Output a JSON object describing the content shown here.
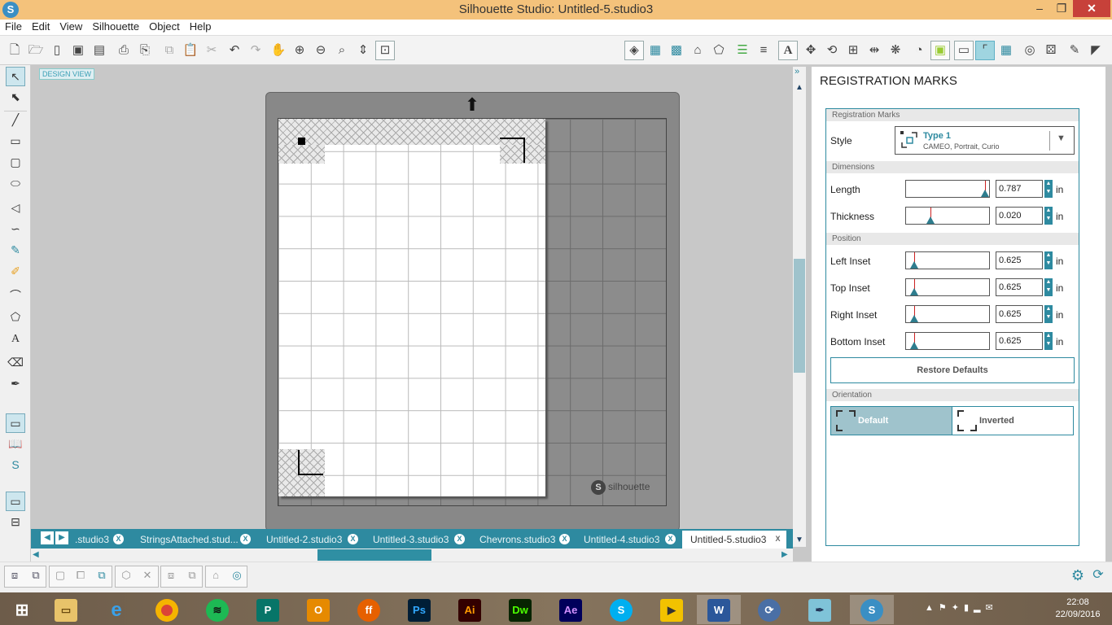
{
  "window": {
    "title": "Silhouette Studio: Untitled-5.studio3",
    "minimize": "‒",
    "restore": "❐",
    "close": "✕"
  },
  "menu": [
    "File",
    "Edit",
    "View",
    "Silhouette",
    "Object",
    "Help"
  ],
  "design_view_label": "DESIGN VIEW",
  "mat_logo": "silhouette",
  "tabs": [
    {
      "label": ".studio3"
    },
    {
      "label": "StringsAttached.stud..."
    },
    {
      "label": "Untitled-2.studio3"
    },
    {
      "label": "Untitled-3.studio3"
    },
    {
      "label": "Chevrons.studio3"
    },
    {
      "label": "Untitled-4.studio3"
    },
    {
      "label": "Untitled-5.studio3"
    }
  ],
  "tab_close": "X",
  "panel": {
    "title": "REGISTRATION MARKS",
    "sections": {
      "registration": "Registration Marks",
      "dimensions": "Dimensions",
      "position": "Position",
      "orientation": "Orientation"
    },
    "style_label": "Style",
    "style_value": "Type 1",
    "style_sub": "CAMEO, Portrait, Curio",
    "fields": {
      "length": {
        "label": "Length",
        "value": "0.787",
        "unit": "in",
        "level": 0.97
      },
      "thickness": {
        "label": "Thickness",
        "value": "0.020",
        "unit": "in",
        "level": 0.3
      },
      "left_inset": {
        "label": "Left Inset",
        "value": "0.625",
        "unit": "in",
        "level": 0.1
      },
      "top_inset": {
        "label": "Top Inset",
        "value": "0.625",
        "unit": "in",
        "level": 0.1
      },
      "right_inset": {
        "label": "Right Inset",
        "value": "0.625",
        "unit": "in",
        "level": 0.1
      },
      "bottom_inset": {
        "label": "Bottom Inset",
        "value": "0.625",
        "unit": "in",
        "level": 0.1
      }
    },
    "restore_defaults": "Restore Defaults",
    "orientation": {
      "default": "Default",
      "inverted": "Inverted",
      "selected": "Default"
    }
  },
  "taskbar": {
    "apps": [
      "Start",
      "File Explorer",
      "Internet Explorer",
      "Chrome",
      "Spotify",
      "Publisher",
      "Outlook",
      "Firefox",
      "Photoshop",
      "Illustrator",
      "Dreamweaver",
      "After Effects",
      "Skype",
      "Media",
      "Word",
      "Sync",
      "Pen",
      "Silhouette Studio"
    ],
    "time": "22:08",
    "date": "22/09/2016"
  },
  "colors": {
    "accent": "#2e8aa0",
    "titlebar": "#f4c27b",
    "close": "#c7413a"
  }
}
